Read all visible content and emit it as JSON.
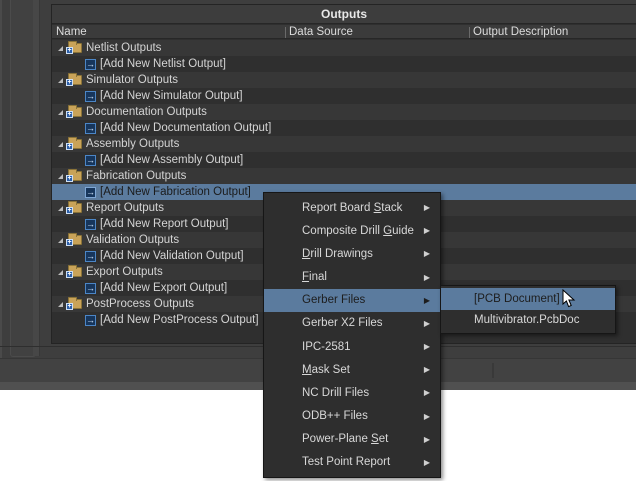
{
  "outputs_panel": {
    "title": "Outputs",
    "columns": {
      "name": "Name",
      "data_source": "Data Source",
      "output_description": "Output Description"
    }
  },
  "tree": {
    "rows": [
      {
        "type": "category",
        "label": "Netlist Outputs"
      },
      {
        "type": "add",
        "label": "[Add New Netlist Output]"
      },
      {
        "type": "category",
        "label": "Simulator Outputs"
      },
      {
        "type": "add",
        "label": "[Add New Simulator Output]"
      },
      {
        "type": "category",
        "label": "Documentation Outputs"
      },
      {
        "type": "add",
        "label": "[Add New Documentation Output]"
      },
      {
        "type": "category",
        "label": "Assembly Outputs"
      },
      {
        "type": "add",
        "label": "[Add New Assembly Output]"
      },
      {
        "type": "category",
        "label": "Fabrication Outputs"
      },
      {
        "type": "add",
        "label": "[Add New Fabrication Output]",
        "selected": true
      },
      {
        "type": "category",
        "label": "Report Outputs"
      },
      {
        "type": "add",
        "label": "[Add New Report Output]"
      },
      {
        "type": "category",
        "label": "Validation Outputs"
      },
      {
        "type": "add",
        "label": "[Add New Validation Output]"
      },
      {
        "type": "category",
        "label": "Export Outputs"
      },
      {
        "type": "add",
        "label": "[Add New Export Output]"
      },
      {
        "type": "category",
        "label": "PostProcess Outputs"
      },
      {
        "type": "add",
        "label": "[Add New PostProcess Output]"
      }
    ],
    "icons": {
      "expander": "expanded-triangle",
      "category": "folder-with-add-badge",
      "add_row": "blue-square-right-arrow"
    },
    "badge_glyph": "+",
    "add_glyph": "→"
  },
  "context_menu": {
    "items": [
      {
        "pre": "Report Board ",
        "u": "S",
        "post": "tack",
        "highlighted": false
      },
      {
        "pre": "Composite Drill ",
        "u": "G",
        "post": "uide",
        "highlighted": false
      },
      {
        "pre": "",
        "u": "D",
        "post": "rill Drawings",
        "highlighted": false
      },
      {
        "pre": "",
        "u": "F",
        "post": "inal",
        "highlighted": false
      },
      {
        "pre": "Gerber Files",
        "u": "",
        "post": "",
        "highlighted": true
      },
      {
        "pre": "Gerber X2 Files",
        "u": "",
        "post": "",
        "highlighted": false
      },
      {
        "pre": "IPC-2581",
        "u": "",
        "post": "",
        "highlighted": false
      },
      {
        "pre": "",
        "u": "M",
        "post": "ask Set",
        "highlighted": false
      },
      {
        "pre": "NC Drill Files",
        "u": "",
        "post": "",
        "highlighted": false
      },
      {
        "pre": "ODB++ Files",
        "u": "",
        "post": "",
        "highlighted": false
      },
      {
        "pre": "Power-Plane ",
        "u": "S",
        "post": "et",
        "highlighted": false
      },
      {
        "pre": "Test Point Report",
        "u": "",
        "post": "",
        "highlighted": false
      }
    ],
    "submenu_arrow": "▶"
  },
  "submenu": {
    "items": [
      {
        "label": "[PCB Document]",
        "highlighted": true
      },
      {
        "label": "Multivibrator.PcbDoc",
        "highlighted": false
      }
    ]
  },
  "colors": {
    "app_background": "#3e3e3e",
    "table_background": "#2f2f2f",
    "row_stripe": "#373737",
    "selection_blue": "#5b7b9e",
    "selection_text": "#1b1b1b",
    "menu_background": "#2e2e2e",
    "menu_text": "#d8d8d8",
    "folder_tan": "#c9a359",
    "icon_blue_border": "#4c86c6"
  }
}
